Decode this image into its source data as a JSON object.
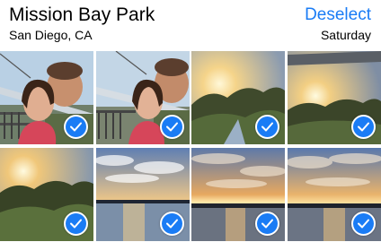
{
  "header": {
    "title": "Mission Bay Park",
    "location": "San Diego, CA",
    "action_label": "Deselect",
    "day_label": "Saturday"
  },
  "colors": {
    "accent": "#1a7cf5",
    "check_mark": "#ffffff"
  },
  "photos": [
    {
      "subject": "selfie-couple",
      "selected": true
    },
    {
      "subject": "selfie-couple",
      "selected": true
    },
    {
      "subject": "sunset-trees",
      "selected": true
    },
    {
      "subject": "sunset-trees",
      "selected": true
    },
    {
      "subject": "sunset-trees",
      "selected": true
    },
    {
      "subject": "sunset-bay",
      "selected": true
    },
    {
      "subject": "sunset-bay",
      "selected": true
    },
    {
      "subject": "sunset-bay",
      "selected": true
    }
  ]
}
